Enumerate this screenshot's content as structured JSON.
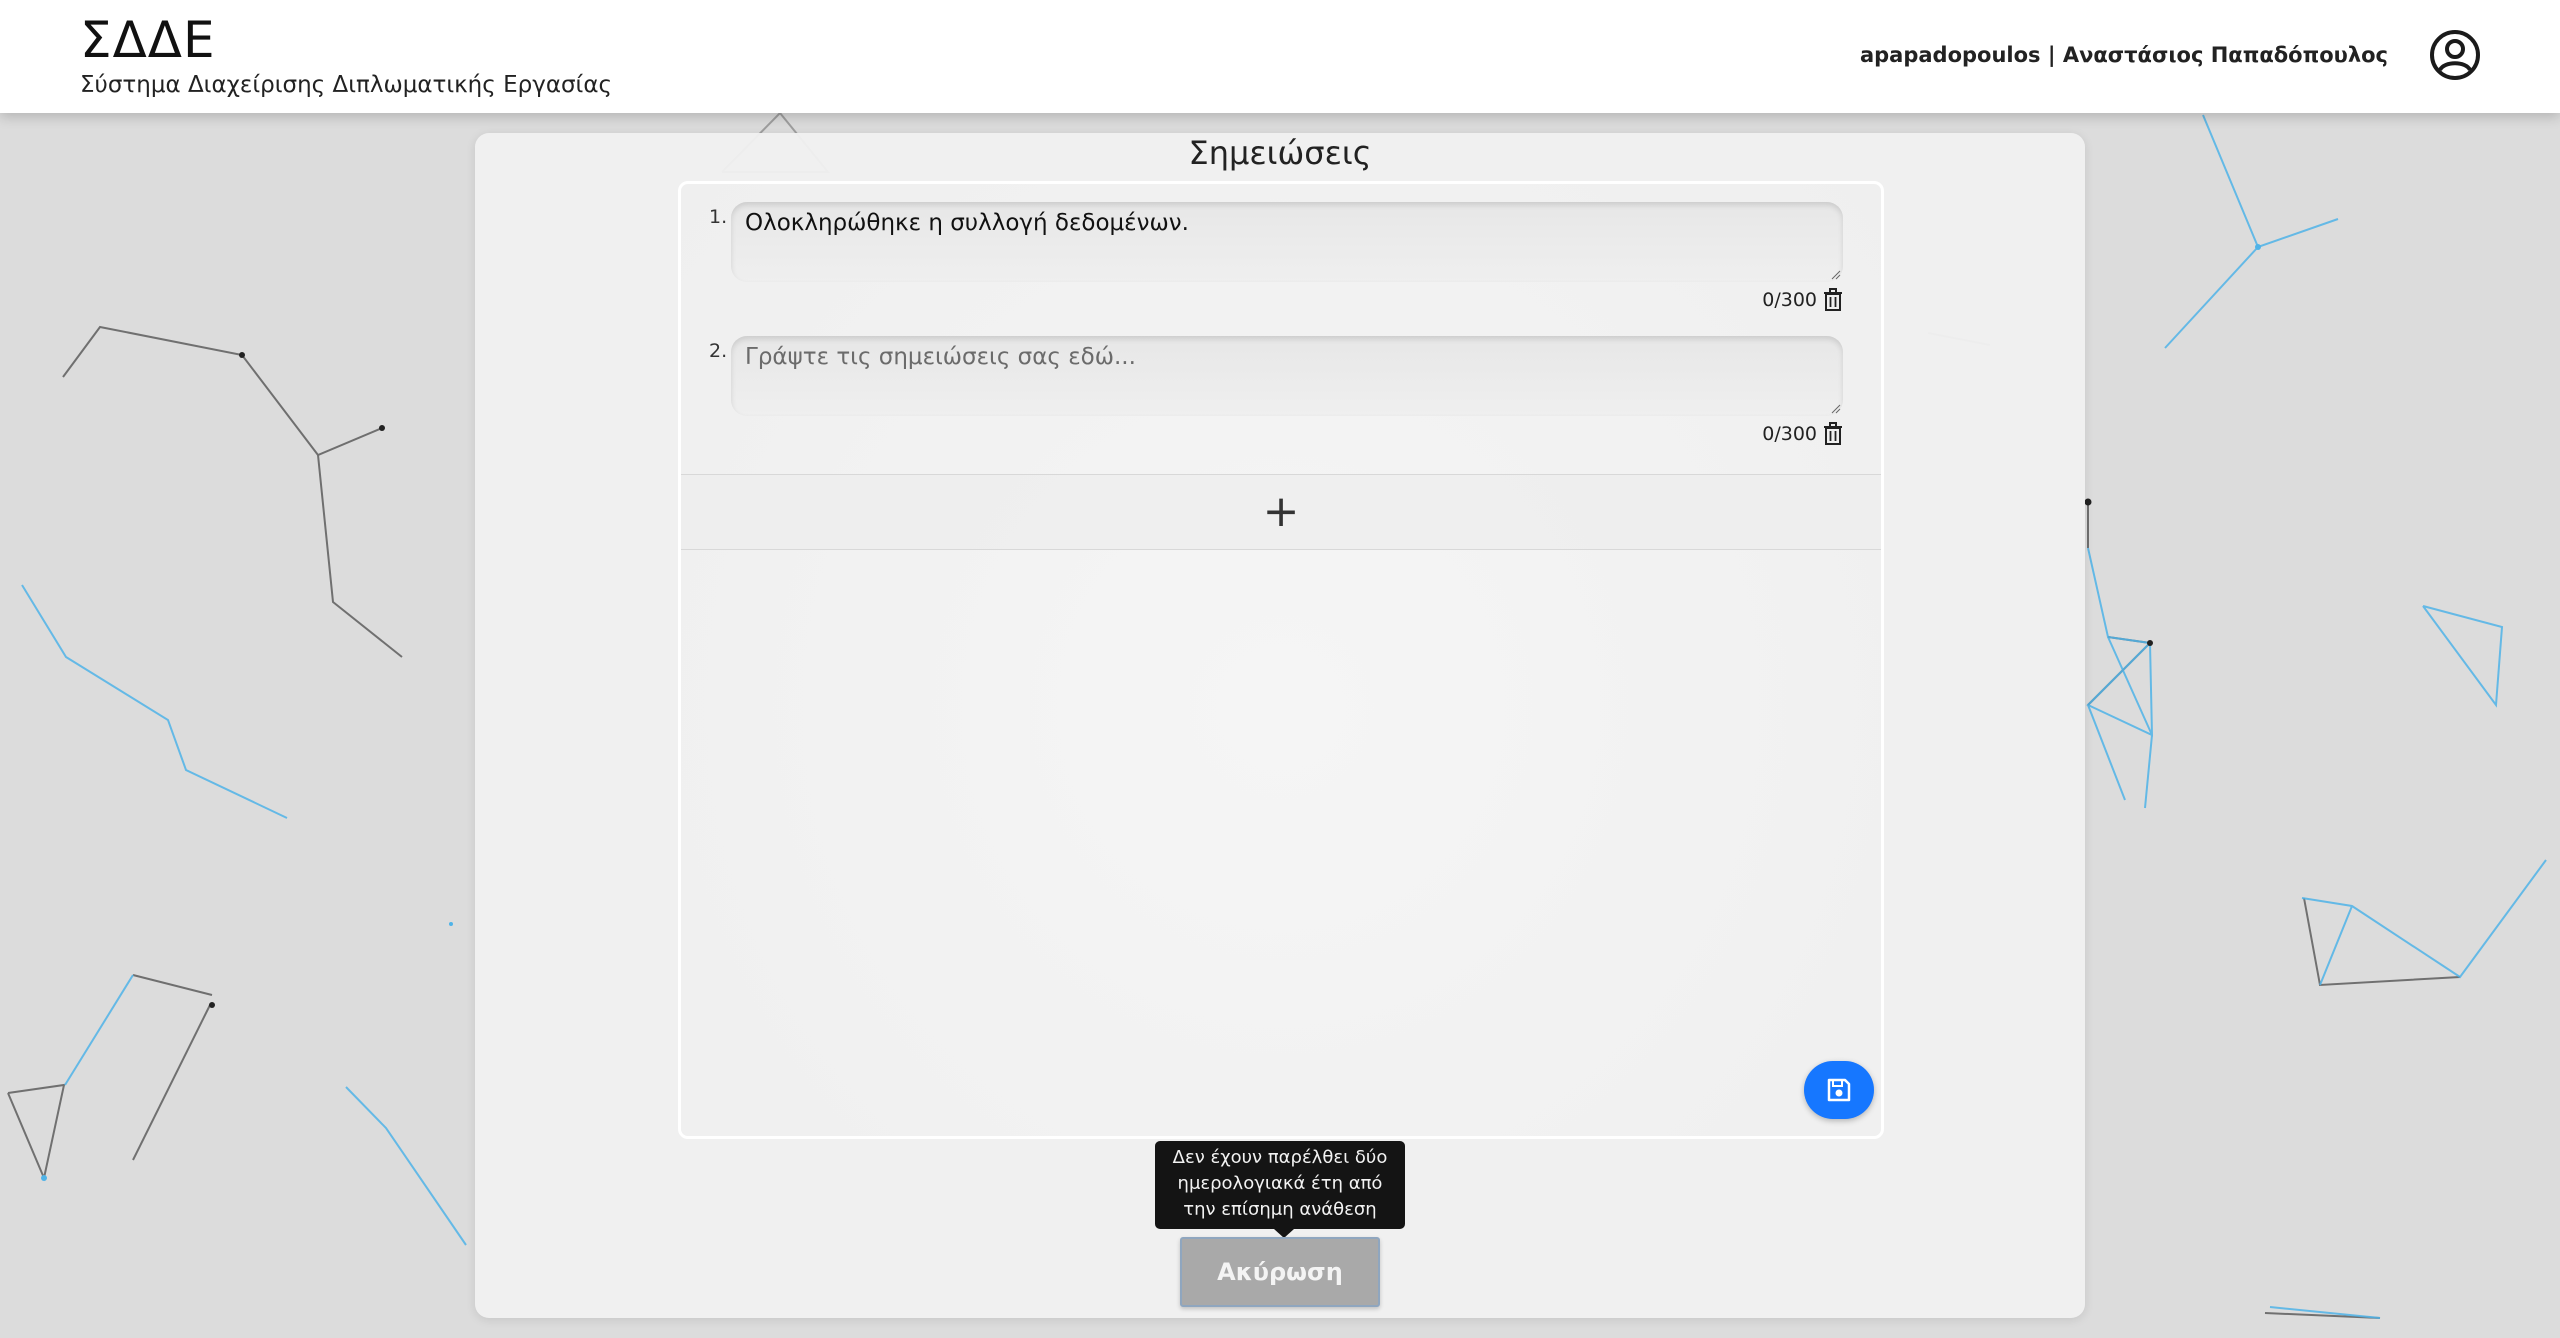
{
  "header": {
    "brand_title": "ΣΔΔΕ",
    "brand_subtitle": "Σύστημα Διαχείρισης Διπλωματικής Εργασίας",
    "user_label": "apapadopoulos | Αναστάσιος Παπαδόπουλος",
    "avatar_icon": "user-circle-icon"
  },
  "card": {
    "title": "Σημειώσεις"
  },
  "notes": [
    {
      "number": "1.",
      "value": "Ολοκληρώθηκε η συλλογή δεδομένων.",
      "placeholder": "Γράψτε τις σημειώσεις σας εδώ...",
      "counter": "0/300"
    },
    {
      "number": "2.",
      "value": "",
      "placeholder": "Γράψτε τις σημειώσεις σας εδώ...",
      "counter": "0/300"
    }
  ],
  "add_button": {
    "label": "+",
    "icon": "plus-icon"
  },
  "save_button": {
    "icon": "floppy-disk-icon"
  },
  "tooltip": {
    "text": "Δεν έχουν παρέλθει δύο ημερολογιακά έτη από την επίσημη ανάθεση"
  },
  "cancel_button": {
    "label": "Ακύρωση"
  },
  "colors": {
    "accent": "#1677ff",
    "background": "#dcdcdc",
    "network_blue": "#4fb3e8",
    "network_dark": "#444444"
  }
}
